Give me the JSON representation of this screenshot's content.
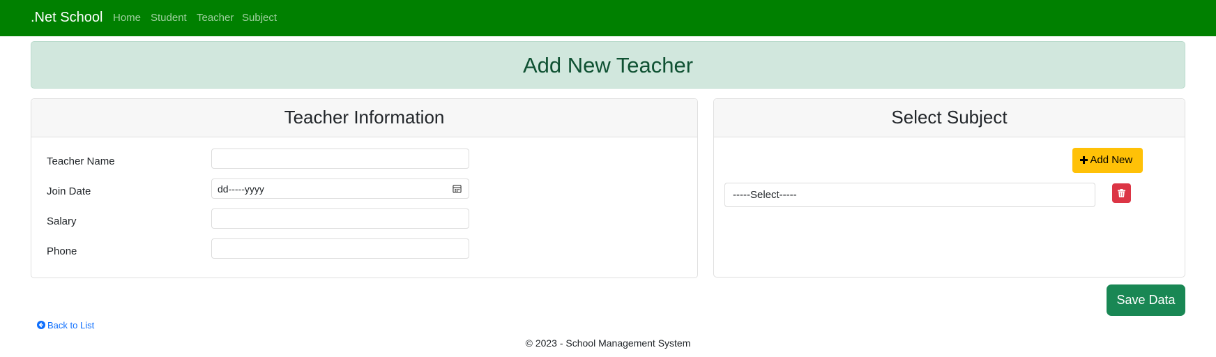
{
  "navbar": {
    "brand": ".Net School",
    "items": [
      {
        "label": "Home"
      },
      {
        "label": "Student"
      },
      {
        "label": "Teacher"
      },
      {
        "label": "Subject"
      }
    ]
  },
  "banner": {
    "title": "Add New Teacher"
  },
  "teacher_info": {
    "title": "Teacher Information",
    "fields": [
      {
        "label": "Teacher Name",
        "value": ""
      },
      {
        "label": "Join Date",
        "value": "dd-----yyyy",
        "icon": "calendar-icon"
      },
      {
        "label": "Salary",
        "value": ""
      },
      {
        "label": "Phone",
        "value": ""
      }
    ]
  },
  "subject": {
    "title": "Select Subject",
    "add_label": "Add New",
    "add_icon": "plus-icon",
    "select_value": "-----Select-----",
    "delete_icon": "trash-icon"
  },
  "actions": {
    "save_label": "Save Data"
  },
  "back_link": {
    "label": "Back to List",
    "icon": "arrow-left-circle-icon"
  },
  "footer": {
    "text": "© 2023 - School Management System"
  },
  "colors": {
    "navbar": "#008000",
    "banner_bg": "#d1e7dd",
    "banner_text": "#0f5132",
    "add_button": "#ffc107",
    "delete_button": "#dc3545",
    "save_button": "#198754",
    "link": "#0d6efd"
  }
}
